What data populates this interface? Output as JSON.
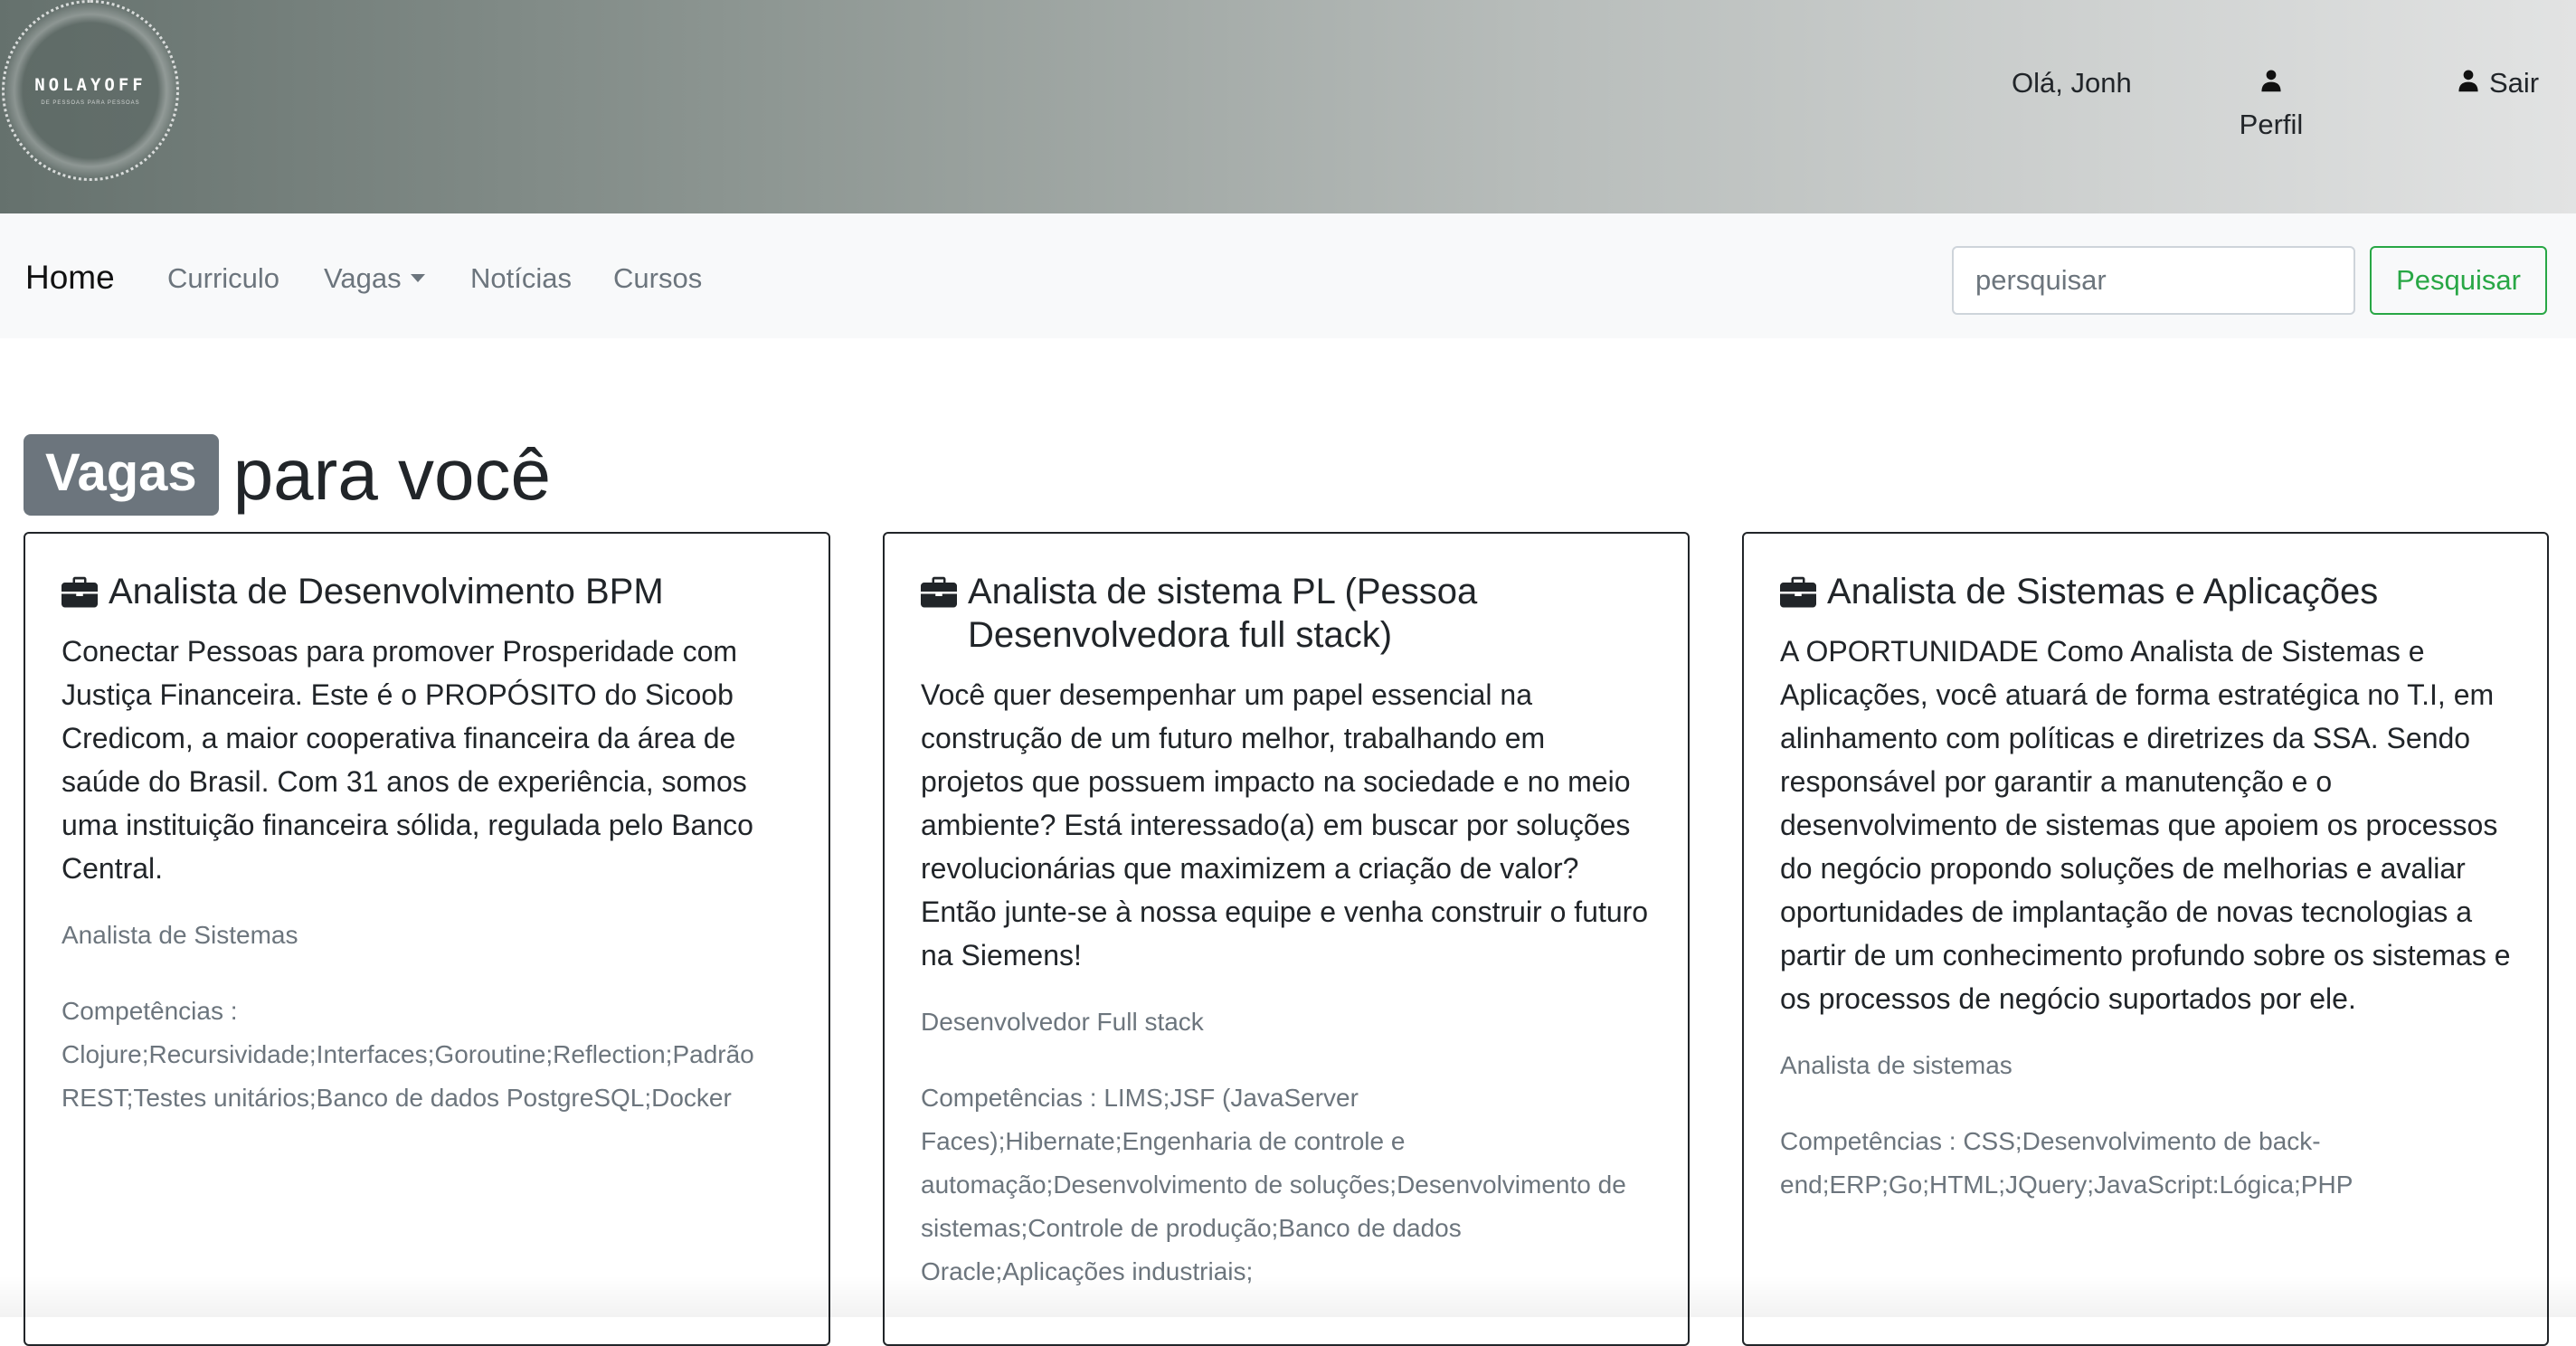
{
  "header": {
    "logo_text": "NOLAYOFF",
    "logo_subtext": "DE PESSOAS PARA PESSOAS",
    "greeting": "Olá, Jonh",
    "profile_label": "Perfil",
    "logout_label": "Sair"
  },
  "nav": {
    "brand": "Home",
    "links": [
      "Curriculo",
      "Vagas",
      "Notícias",
      "Cursos"
    ],
    "search_placeholder": "persquisar",
    "search_button": "Pesquisar"
  },
  "heading": {
    "badge": "Vagas",
    "text": "para você"
  },
  "cards": [
    {
      "title": "Analista de Desenvolvimento BPM",
      "description": "Conectar Pessoas para promover Prosperidade com Justiça Financeira. Este é o PROPÓSITO do Sicoob Credicom, a maior cooperativa financeira da área de saúde do Brasil. Com 31 anos de experiência, somos uma instituição financeira sólida, regulada pelo Banco Central.",
      "category": "Analista de Sistemas",
      "skills": "Competências : Clojure;Recursividade;Interfaces;Goroutine;Reflection;Padrão REST;Testes unitários;Banco de dados PostgreSQL;Docker"
    },
    {
      "title": "Analista de sistema PL (Pessoa Desenvolvedora full stack)",
      "description": "Você quer desempenhar um papel essencial na construção de um futuro melhor, trabalhando em projetos que possuem impacto na sociedade e no meio ambiente? Está interessado(a) em buscar por soluções revolucionárias que maximizem a criação de valor? Então junte-se à nossa equipe e venha construir o futuro na Siemens!",
      "category": "Desenvolvedor Full stack",
      "skills": "Competências : LIMS;JSF (JavaServer Faces);Hibernate;Engenharia de controle e automação;Desenvolvimento de soluções;Desenvolvimento de sistemas;Controle de produção;Banco de dados Oracle;Aplicações industriais;"
    },
    {
      "title": "Analista de Sistemas e Aplicações",
      "description": "A OPORTUNIDADE Como Analista de Sistemas e Aplicações, você atuará de forma estratégica no T.I, em alinhamento com políticas e diretrizes da SSA. Sendo responsável por garantir a manutenção e o desenvolvimento de sistemas que apoiem os processos do negócio propondo soluções de melhorias e avaliar oportunidades de implantação de novas tecnologias a partir de um conhecimento profundo sobre os sistemas e os processos de negócio suportados por ele.",
      "category": "Analista de sistemas",
      "skills": "Competências : CSS;Desenvolvimento de back-end;ERP;Go;HTML;JQuery;JavaScript:Lógica;PHP"
    }
  ],
  "icons": {
    "profile": "person-icon",
    "logout": "person-icon",
    "card": "briefcase-icon",
    "dropdown": "caret-down-icon"
  },
  "colors": {
    "badge_bg": "#6c757d",
    "search_button": "#28a745",
    "navbar_bg": "#f8f9fa",
    "muted_text": "#6c757d"
  }
}
